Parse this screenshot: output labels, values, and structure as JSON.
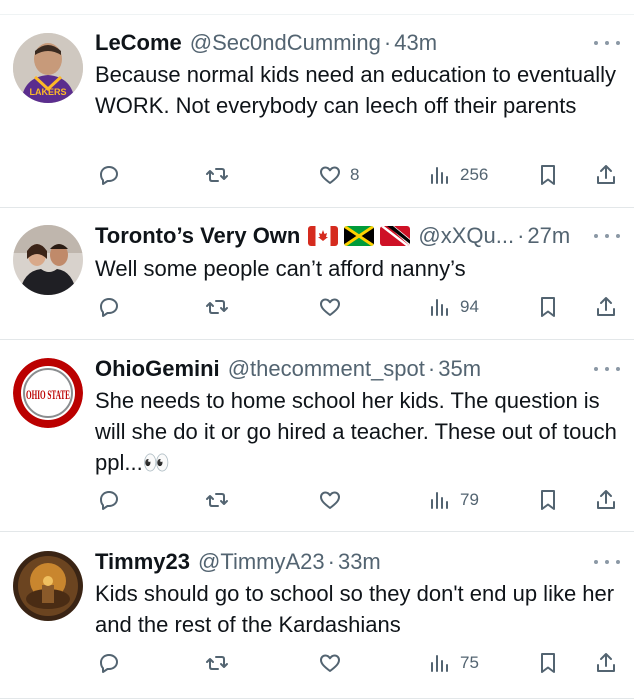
{
  "tweets": [
    {
      "name": "LeCome",
      "handle": "@Sec0ndCumming",
      "sep": "·",
      "time": "43m",
      "text": "Because normal kids need an education to eventually WORK. Not everybody can leech off their parents",
      "likes": "8",
      "views": "256",
      "avatar_icon": "avatar-lakers-jersey"
    },
    {
      "name": "Toronto’s Very Own",
      "flags": [
        "canada-flag-icon",
        "jamaica-flag-icon",
        "trinidad-flag-icon"
      ],
      "handle": "@xXQu...",
      "sep": "·",
      "time": "27m",
      "text": "Well some people can’t afford nanny’s",
      "likes": "",
      "views": "94",
      "avatar_icon": "avatar-photo-couple"
    },
    {
      "name": "OhioGemini",
      "handle": "@thecomment_spot",
      "sep": "·",
      "time": "35m",
      "text": "She needs to home school her kids. The question is will she do it or go hired a teacher. These out of touch ppl...👀",
      "likes": "",
      "views": "79",
      "avatar_icon": "ohio-state-logo",
      "avatar_text": "OHIO STATE"
    },
    {
      "name": "Timmy23",
      "handle": "@TimmyA23",
      "sep": "·",
      "time": "33m",
      "text": "Kids should go to school so they don't end up like her and the rest of the Kardashians",
      "likes": "",
      "views": "75",
      "avatar_icon": "avatar-album-art"
    }
  ],
  "colors": {
    "icon_gray": "#536471",
    "divider": "#e3e7e9",
    "ohio_red": "#bb0000"
  }
}
